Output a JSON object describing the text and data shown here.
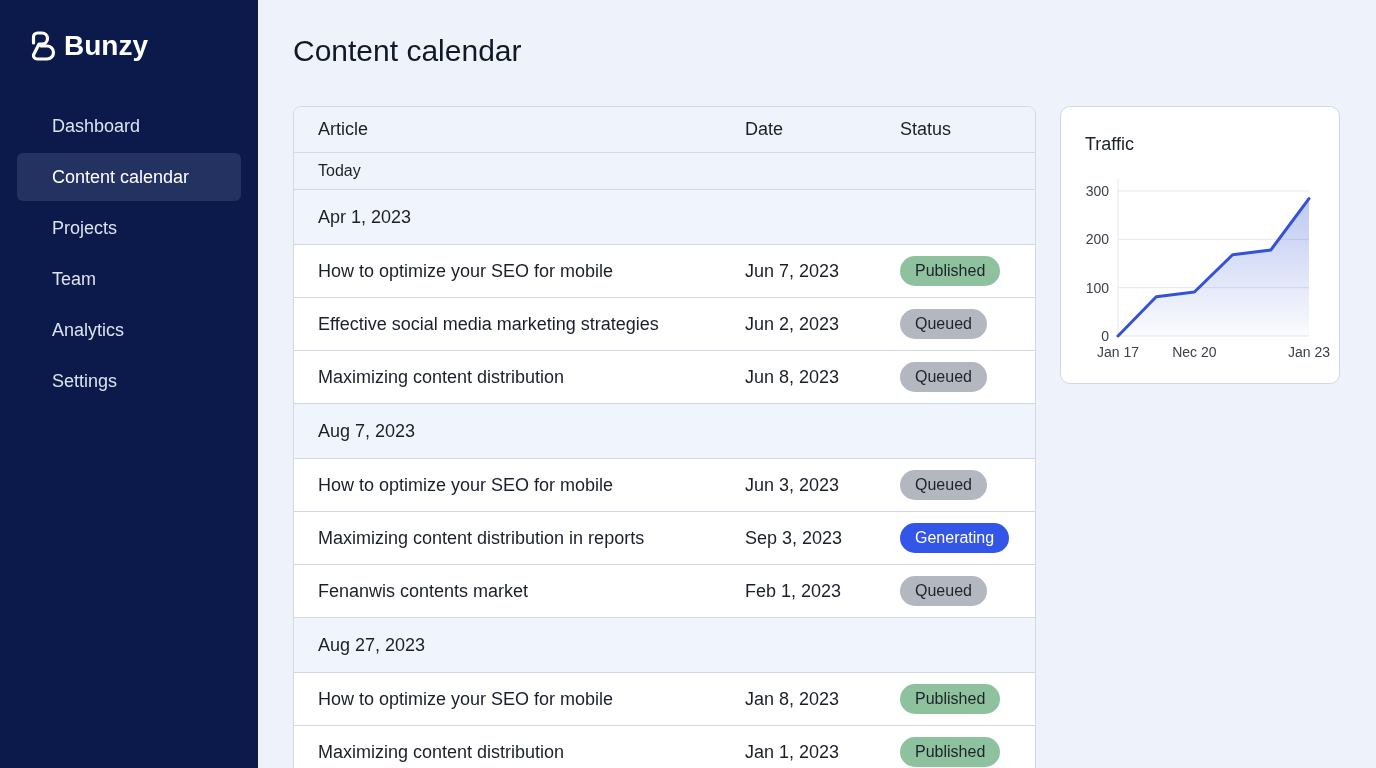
{
  "sidebar": {
    "brand": "Bunzy",
    "items": [
      {
        "label": "Dashboard",
        "selected": false
      },
      {
        "label": "Content calendar",
        "selected": true
      },
      {
        "label": "Projects",
        "selected": false
      },
      {
        "label": "Team",
        "selected": false
      },
      {
        "label": "Analytics",
        "selected": false
      },
      {
        "label": "Settings",
        "selected": false
      }
    ]
  },
  "page": {
    "title": "Content calendar"
  },
  "table": {
    "columns": [
      "Article",
      "Date",
      "Status"
    ],
    "section_label": "Today",
    "groups": [
      {
        "date": "Apr 1, 2023",
        "rows": [
          {
            "article": "How to optimize your SEO for mobile",
            "date": "Jun 7, 2023",
            "status": {
              "label": "Published",
              "color": "#8ec29f"
            }
          },
          {
            "article": "Effective social media marketing strategies",
            "date": "Jun 2, 2023",
            "status": {
              "label": "Queued",
              "color": "#b3b7c0"
            }
          },
          {
            "article": "Maximizing content distribution",
            "date": "Jun 8, 2023",
            "status": {
              "label": "Queued",
              "color": "#b3b7c0"
            }
          }
        ]
      },
      {
        "date": "Aug 7, 2023",
        "rows": [
          {
            "article": "How to optimize your SEO for mobile",
            "date": "Jun 3, 2023",
            "status": {
              "label": "Queued",
              "color": "#b3b7c0"
            }
          },
          {
            "article": "Maximizing content distribution in reports",
            "date": "Sep 3, 2023",
            "status": {
              "label": "Generating",
              "color": "#3355e8"
            }
          },
          {
            "article": "Fenanwis contents market",
            "date": "Feb 1, 2023",
            "status": {
              "label": "Queued",
              "color": "#b3b7c0"
            }
          }
        ]
      },
      {
        "date": "Aug 27, 2023",
        "rows": [
          {
            "article": "How to optimize your SEO for mobile",
            "date": "Jan 8, 2023",
            "status": {
              "label": "Published",
              "color": "#8ec29f"
            }
          },
          {
            "article": "Maximizing content distribution",
            "date": "Jan 1, 2023",
            "status": {
              "label": "Published",
              "color": "#8ec29f"
            }
          }
        ]
      }
    ]
  },
  "traffic": {
    "chart_data": {
      "type": "area",
      "title": "Traffic",
      "categories": [
        "Jan 17",
        null,
        "Nec 20",
        null,
        null,
        "Jan 23"
      ],
      "ylim": [
        0,
        300
      ],
      "yticks": [
        0,
        100,
        200,
        300
      ],
      "series": [
        {
          "color": "#3352d6",
          "values": [
            0,
            81,
            91,
            168,
            178,
            284
          ]
        }
      ]
    }
  }
}
